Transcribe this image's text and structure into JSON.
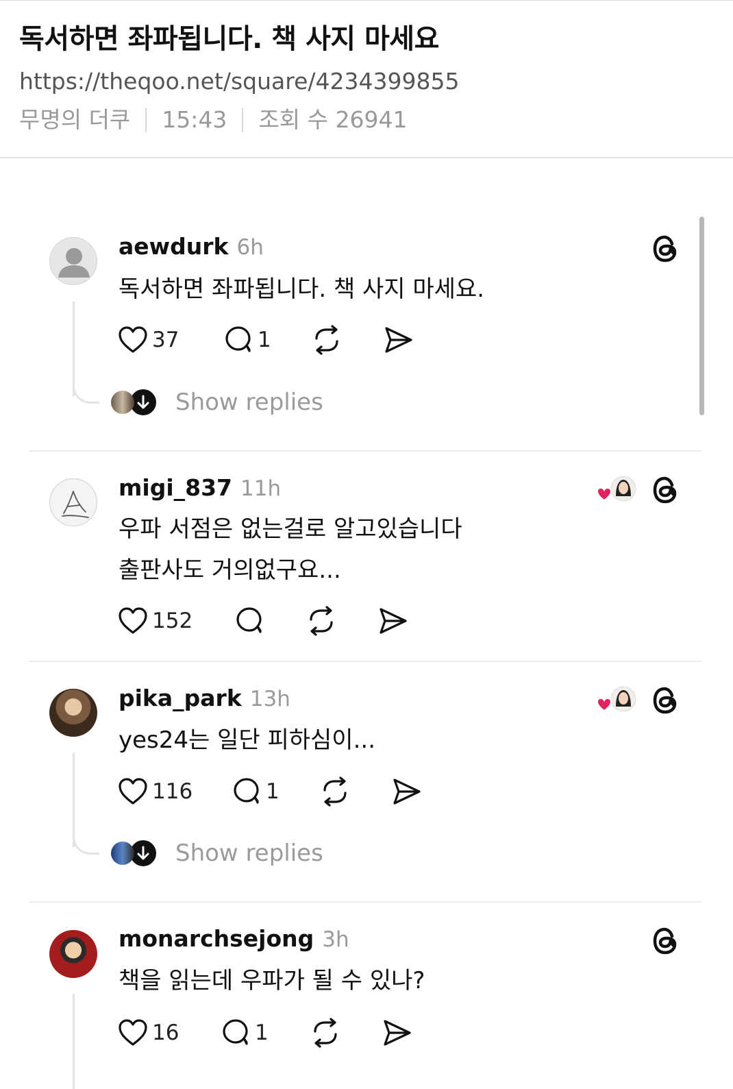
{
  "article": {
    "title": "독서하면 좌파됩니다. 책 사지 마세요",
    "url": "https://theqoo.net/square/4234399855",
    "author": "무명의 더쿠",
    "time": "15:43",
    "views": "조회 수 26941"
  },
  "posts": [
    {
      "username": "aewdurk",
      "time": "6h",
      "lines": [
        "독서하면 좌파됩니다. 책 사지 마세요."
      ],
      "likes": "37",
      "replies": "1",
      "show_replies": "Show replies"
    },
    {
      "username": "migi_837",
      "time": "11h",
      "lines": [
        "우파 서점은 없는걸로 알고있습니다",
        "출판사도 거의없구요..."
      ],
      "likes": "152",
      "replies": ""
    },
    {
      "username": "pika_park",
      "time": "13h",
      "lines": [
        "yes24는 일단 피하심이..."
      ],
      "likes": "116",
      "replies": "1",
      "show_replies": "Show replies"
    },
    {
      "username": "monarchsejong",
      "time": "3h",
      "lines": [
        "책을 읽는데 우파가 될 수 있나?"
      ],
      "likes": "16",
      "replies": "1"
    }
  ],
  "icons": {
    "like": "heart-icon",
    "reply": "comment-icon",
    "repost": "repost-icon",
    "share": "send-icon",
    "app": "threads-icon"
  },
  "colors": {
    "heart_red": "#e0245e",
    "muted": "#999999",
    "text": "#111111"
  }
}
